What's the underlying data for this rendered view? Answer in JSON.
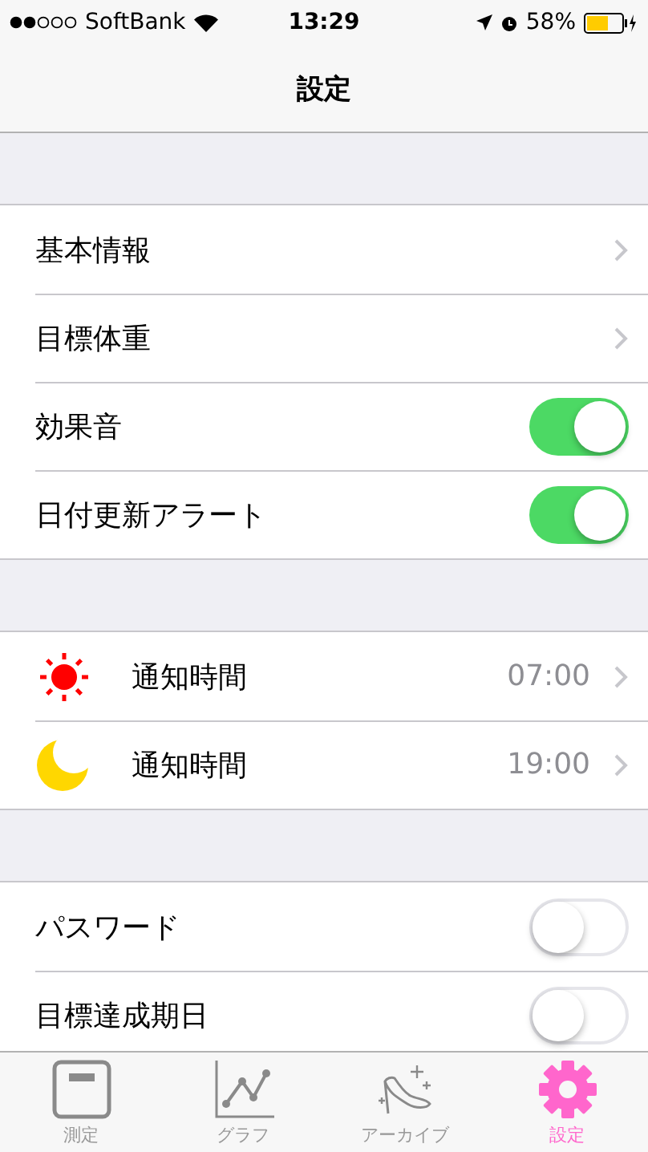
{
  "status_bar": {
    "carrier": "SoftBank",
    "time": "13:29",
    "battery": "58%"
  },
  "nav": {
    "title": "設定"
  },
  "sections": [
    {
      "rows": [
        {
          "kind": "link",
          "label": "基本情報"
        },
        {
          "kind": "link",
          "label": "目標体重"
        },
        {
          "kind": "toggle",
          "label": "効果音",
          "on": true
        },
        {
          "kind": "toggle",
          "label": "日付更新アラート",
          "on": true
        }
      ]
    },
    {
      "rows": [
        {
          "kind": "time",
          "label": "通知時間",
          "value": "07:00"
        },
        {
          "kind": "time",
          "label": "通知時間",
          "value": "19:00"
        }
      ]
    },
    {
      "rows": [
        {
          "kind": "toggle",
          "label": "パスワード",
          "on": false
        },
        {
          "kind": "toggle",
          "label": "目標達成期日",
          "on": false
        }
      ]
    }
  ],
  "tabs": [
    {
      "label": "測定",
      "selected": false
    },
    {
      "label": "グラフ",
      "selected": false
    },
    {
      "label": "アーカイブ",
      "selected": false
    },
    {
      "label": "設定",
      "selected": true
    }
  ]
}
